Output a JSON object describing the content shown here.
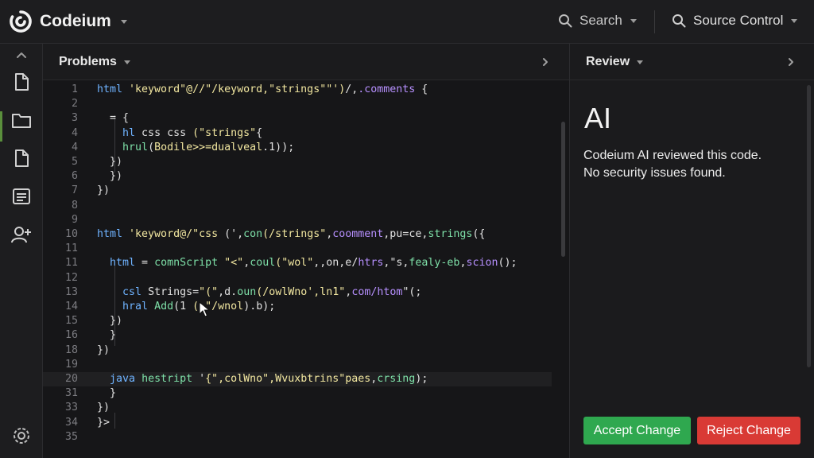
{
  "app": {
    "name": "Codeium"
  },
  "topbar": {
    "search_label": "Search",
    "source_control_label": "Source Control"
  },
  "rail": {
    "icons": [
      "collapse-up-icon",
      "file-icon",
      "folder-icon",
      "file-icon",
      "list-icon",
      "add-user-icon",
      "settings-icon"
    ]
  },
  "editor": {
    "panel_title": "Problems",
    "lines": [
      {
        "no": "1",
        "code": [
          [
            "kw",
            "html "
          ],
          [
            "str",
            "'keyword\"@//\"/keyword,\"strings\"\"')"
          ],
          [
            "pl",
            "/,"
          ],
          [
            "cm",
            ".comments"
          ],
          [
            "pl",
            " {"
          ]
        ]
      },
      {
        "no": "2",
        "code": []
      },
      {
        "no": "3",
        "code": [
          [
            "pl",
            "  = {"
          ]
        ]
      },
      {
        "no": "4",
        "code": [
          [
            "pl",
            "    "
          ],
          [
            "kw",
            "hl"
          ],
          [
            "pl",
            " css css "
          ],
          [
            "str",
            "(\"strings\""
          ],
          [
            "pl",
            "{"
          ]
        ]
      },
      {
        "no": "4",
        "code": [
          [
            "pl",
            "    "
          ],
          [
            "fn",
            "hrul"
          ],
          [
            "pl",
            "("
          ],
          [
            "str",
            "Bodile>>=dualveal"
          ],
          [
            "pl",
            ".1));"
          ]
        ]
      },
      {
        "no": "5",
        "code": [
          [
            "pl",
            "  })"
          ]
        ]
      },
      {
        "no": "6",
        "code": [
          [
            "pl",
            "  })"
          ]
        ]
      },
      {
        "no": "7",
        "code": [
          [
            "pl",
            "})"
          ]
        ]
      },
      {
        "no": "8",
        "code": []
      },
      {
        "no": "9",
        "code": []
      },
      {
        "no": "10",
        "code": [
          [
            "kw",
            "html "
          ],
          [
            "str",
            "'keyword@/\"css"
          ],
          [
            "pl",
            " (',"
          ],
          [
            "fn",
            "con"
          ],
          [
            "str",
            "(/strings\""
          ],
          [
            "pl",
            ","
          ],
          [
            "cm",
            "coomment"
          ],
          [
            "pl",
            ",pu=ce,"
          ],
          [
            "fn",
            "strings"
          ],
          [
            "pl",
            "({"
          ]
        ]
      },
      {
        "no": "11",
        "code": []
      },
      {
        "no": "11",
        "code": [
          [
            "pl",
            "  "
          ],
          [
            "kw",
            "html"
          ],
          [
            "pl",
            " = "
          ],
          [
            "fn",
            "comnScript"
          ],
          [
            "pl",
            " "
          ],
          [
            "str",
            "\"<\""
          ],
          [
            "pl",
            ","
          ],
          [
            "fn",
            "coul"
          ],
          [
            "str",
            "(\"wol\""
          ],
          [
            "pl",
            ",,on,e/"
          ],
          [
            "cm",
            "htrs"
          ],
          [
            "pl",
            ",\"s,"
          ],
          [
            "fn",
            "fealy-eb"
          ],
          [
            "pl",
            ","
          ],
          [
            "cm",
            "scion"
          ],
          [
            "pl",
            "();"
          ]
        ]
      },
      {
        "no": "12",
        "code": []
      },
      {
        "no": "13",
        "code": [
          [
            "pl",
            "    "
          ],
          [
            "kw",
            "csl"
          ],
          [
            "pl",
            " Strings="
          ],
          [
            "str",
            "\"(\""
          ],
          [
            "pl",
            ",d."
          ],
          [
            "fn",
            "oun"
          ],
          [
            "str",
            "(/owlWno',ln1\""
          ],
          [
            "pl",
            ","
          ],
          [
            "cm",
            "com/htom"
          ],
          [
            "pl",
            "\"(;"
          ]
        ]
      },
      {
        "no": "14",
        "code": [
          [
            "pl",
            "    "
          ],
          [
            "kw",
            "hral"
          ],
          [
            "pl",
            " "
          ],
          [
            "fn",
            "Add"
          ],
          [
            "pl",
            "(1 "
          ],
          [
            "str",
            "( \"/wnol"
          ],
          [
            "pl",
            ").b);"
          ]
        ]
      },
      {
        "no": "15",
        "code": [
          [
            "pl",
            "  })"
          ]
        ]
      },
      {
        "no": "16",
        "code": [
          [
            "pl",
            "  }"
          ]
        ]
      },
      {
        "no": "18",
        "code": [
          [
            "pl",
            "})"
          ]
        ]
      },
      {
        "no": "19",
        "code": []
      },
      {
        "no": "20",
        "code": [
          [
            "pl",
            "  "
          ],
          [
            "kw",
            "java"
          ],
          [
            "pl",
            " "
          ],
          [
            "fn",
            "hestript"
          ],
          [
            "pl",
            " '"
          ],
          [
            "str",
            "{\",colWno\",Wvuxbtrins\"paes"
          ],
          [
            "pl",
            ","
          ],
          [
            "fn",
            "crsing"
          ],
          [
            "pl",
            ");"
          ]
        ]
      },
      {
        "no": "31",
        "code": [
          [
            "pl",
            "  }"
          ]
        ]
      },
      {
        "no": "33",
        "code": [
          [
            "pl",
            "})"
          ]
        ]
      },
      {
        "no": "34",
        "code": [
          [
            "pl",
            "}>"
          ]
        ]
      },
      {
        "no": "35",
        "code": []
      }
    ]
  },
  "review": {
    "panel_title": "Review",
    "heading": "AI",
    "message_line1": "Codeium AI reviewed this code.",
    "message_line2": "No security issues found.",
    "accept_label": "Accept Change",
    "reject_label": "Reject Change"
  },
  "colors": {
    "accent_active": "#5a8f3c",
    "accept": "#2fa84f",
    "reject": "#d93a35",
    "keyword": "#6fb3ff",
    "string": "#f2e7a0",
    "comment": "#b790ff",
    "function": "#7ee0a8"
  }
}
